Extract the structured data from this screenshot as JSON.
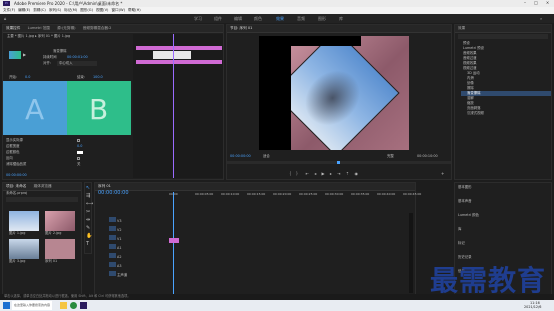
{
  "window": {
    "title": "Adobe Premiere Pro 2020 - C:\\用户\\Admin\\桌面\\未命名 *"
  },
  "menu": [
    "文件(F)",
    "编辑(E)",
    "剪辑(C)",
    "序列(S)",
    "标记(M)",
    "图形(G)",
    "视图(V)",
    "窗口(W)",
    "帮助(H)"
  ],
  "workspaces": [
    "学习",
    "组件",
    "编辑",
    "颜色",
    "效果",
    "音频",
    "图形",
    "库"
  ],
  "effect_controls": {
    "tabs": [
      "效果控件",
      "Lumetri 范围",
      "源:(无剪辑)",
      "音频剪辑混合器:2"
    ],
    "clip_path": "主要 * 图片 1.jpg ▸ 序列 01 * 图片 1.jpg",
    "transition": "渐变擦除",
    "duration_label": "持续时间",
    "duration_value": "00:00:01:00",
    "align_label": "对齐:",
    "align_value": "中心切入",
    "start_label": "开始:",
    "start_value": "0.0",
    "end_label": "结束:",
    "end_value": "100.0",
    "a": "A",
    "b": "B",
    "show_actual": "显示实际源",
    "border_width": "边框宽度",
    "border_color": "边框颜色",
    "reverse": "反向",
    "antialias": "消除锯齿品质",
    "antialias_value": "关",
    "timecode": "00:00:00:00"
  },
  "program": {
    "tabs": [
      "节目: 序列 01",
      "≡"
    ],
    "timecode_left": "00:00:00:00",
    "fit": "适合",
    "quality": "完整",
    "timecode_right": "00:00:10:00"
  },
  "source_clips": [
    "第1张(1)桌面图片.jpg",
    "第2张(2)桌面图片.jpg"
  ],
  "project": {
    "tabs": [
      "项目: 未命名",
      "媒体浏览器"
    ],
    "name": "未命名.prproj",
    "items": [
      {
        "name": "图片 1.jpg",
        "dur": "5:00"
      },
      {
        "name": "图片 2.jpg",
        "dur": "5:00"
      },
      {
        "name": "图片 3.jpg",
        "dur": "5:00"
      },
      {
        "name": "序列 01",
        "dur": "10:00"
      }
    ]
  },
  "timeline": {
    "tab": "序列 01",
    "timecode": "00:00:00:00",
    "ruler": [
      "00:00",
      "00:00:05:00",
      "00:00:10:00",
      "00:00:15:00",
      "00:00:20:00",
      "00:00:25:00",
      "00:00:30:00",
      "00:00:35:00",
      "00:00:40:00",
      "00:00:45:00"
    ],
    "tracks": [
      "V3",
      "V2",
      "V1",
      "A1",
      "A2",
      "A3",
      "主声道"
    ],
    "master_value": "0.0"
  },
  "effects_panel": {
    "title": "效果",
    "items": [
      "预设",
      "Lumetri 预设",
      "音频效果",
      "音频过渡",
      "视频效果",
      "视频过渡",
      "3D 运动",
      "内滑",
      "划像",
      "擦除",
      "渐变擦除",
      "溶解",
      "缩放",
      "页面剥落",
      "沉浸式视频"
    ],
    "bottom": [
      "基本图形",
      "基本声音",
      "Lumetri 颜色",
      "库",
      "标记",
      "历史记录",
      "信息"
    ]
  },
  "status": {
    "hint": "单击以选择，或单击空白处并拖动以进行框选。使用 Shift、Alt 和 Ctrl 可获得其他选项。"
  },
  "taskbar": {
    "time": "11:16",
    "date": "2021/12/6",
    "search": "在这里输入你要搜索的内容"
  },
  "watermark": {
    "text": "最需教育"
  },
  "colors": {
    "accent_blue": "#2f7de1",
    "clip_pink": "#d06ad3",
    "a_blue": "#4a9fd5",
    "b_green": "#2ebe8a",
    "purple_line": "#9a6bff"
  }
}
